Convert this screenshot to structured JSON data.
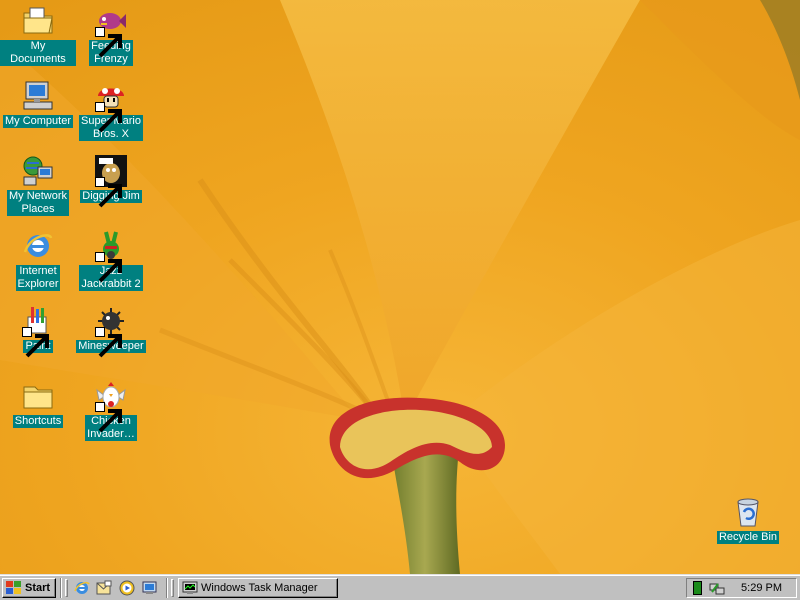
{
  "desktop": {
    "icons": [
      {
        "label": "My Documents",
        "icon": "my-documents-icon"
      },
      {
        "label": "My Computer",
        "icon": "my-computer-icon"
      },
      {
        "label": "My Network\nPlaces",
        "icon": "network-places-icon"
      },
      {
        "label": "Internet\nExplorer",
        "icon": "internet-explorer-icon"
      },
      {
        "label": "Paint",
        "icon": "paint-icon"
      },
      {
        "label": "Shortcuts",
        "icon": "folder-icon"
      },
      {
        "label": "Feeding\nFrenzy",
        "icon": "fish-icon"
      },
      {
        "label": "Super Mario\nBros. X",
        "icon": "mushroom-icon"
      },
      {
        "label": "Digging Jim",
        "icon": "digging-jim-icon"
      },
      {
        "label": "Jazz\nJackrabbit 2",
        "icon": "rabbit-icon"
      },
      {
        "label": "Minesweeper",
        "icon": "mine-icon"
      },
      {
        "label": "Chicken\nInvader…",
        "icon": "chicken-icon"
      },
      {
        "label": "Recycle Bin",
        "icon": "recycle-bin-icon"
      }
    ]
  },
  "taskbar": {
    "start_label": "Start",
    "quick_launch": [
      "internet-explorer-icon",
      "outlook-express-icon",
      "media-player-icon",
      "show-desktop-icon"
    ],
    "task_button_label": "Windows Task Manager",
    "clock": "5:29 PM"
  },
  "colors": {
    "label_bg": "#008080",
    "taskbar": "#c0c0c0",
    "wallpaper": "#f0a820"
  }
}
